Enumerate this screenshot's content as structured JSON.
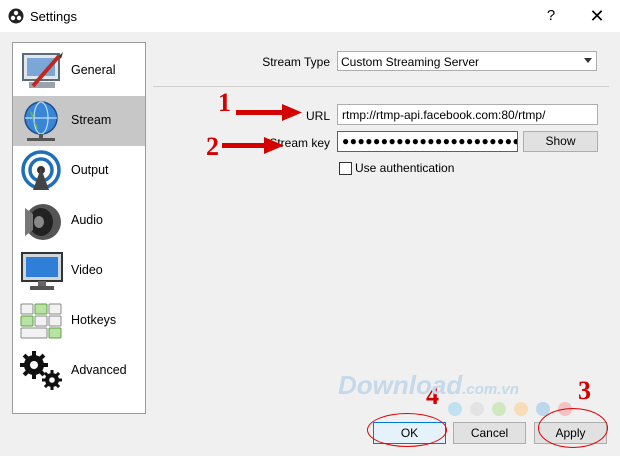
{
  "window": {
    "title": "Settings",
    "help_glyph": "?",
    "close_glyph": "✕",
    "app_icon": "obs-icon"
  },
  "sidebar": {
    "items": [
      {
        "label": "General",
        "icon": "general-icon"
      },
      {
        "label": "Stream",
        "icon": "stream-globe-icon",
        "selected": true
      },
      {
        "label": "Output",
        "icon": "output-antenna-icon"
      },
      {
        "label": "Audio",
        "icon": "audio-speaker-icon"
      },
      {
        "label": "Video",
        "icon": "video-monitor-icon"
      },
      {
        "label": "Hotkeys",
        "icon": "hotkeys-keyboard-icon"
      },
      {
        "label": "Advanced",
        "icon": "advanced-gears-icon"
      }
    ]
  },
  "stream": {
    "type_label": "Stream Type",
    "type_value": "Custom Streaming Server",
    "url_label": "URL",
    "url_value": "rtmp://rtmp-api.facebook.com:80/rtmp/",
    "key_label": "Stream key",
    "key_value": "●●●●●●●●●●●●●●●●●●●●●●●●●●●●●●",
    "show_label": "Show",
    "auth_label": "Use authentication",
    "auth_checked": false
  },
  "footer": {
    "ok_label": "OK",
    "cancel_label": "Cancel",
    "apply_label": "Apply"
  },
  "annotations": {
    "n1": "1",
    "n2": "2",
    "n3": "3",
    "n4": "4",
    "color": "#d40000"
  },
  "watermark": {
    "main": "Download",
    "suffix": ".com.vn"
  }
}
